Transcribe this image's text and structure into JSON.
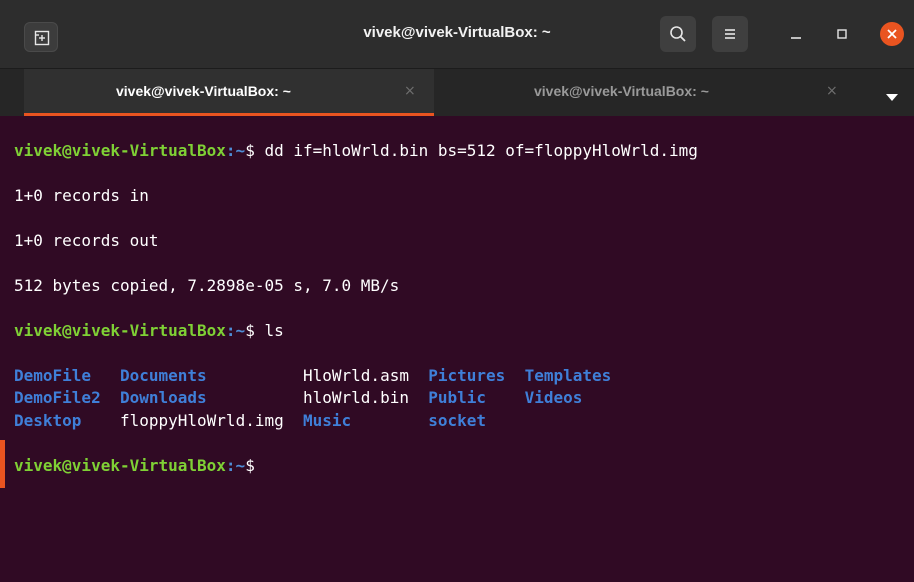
{
  "window": {
    "title": "vivek@vivek-VirtualBox: ~"
  },
  "tabs": [
    {
      "label": "vivek@vivek-VirtualBox: ~",
      "close": "×",
      "active": true
    },
    {
      "label": "vivek@vivek-VirtualBox: ~",
      "close": "×",
      "active": false
    }
  ],
  "terminal": {
    "prompt_user": "vivek@vivek-VirtualBox",
    "prompt_path": ":~",
    "prompt_symbol": "$",
    "commands": [
      " dd if=hloWrld.bin bs=512 of=floppyHloWrld.img",
      " ls"
    ],
    "output": [
      "1+0 records in",
      "1+0 records out",
      "512 bytes copied, 7.2898e-05 s, 7.0 MB/s"
    ],
    "ls_rows": [
      [
        {
          "name": "DemoFile",
          "type": "dir",
          "pad": "   "
        },
        {
          "name": "Documents",
          "type": "dir",
          "pad": "          "
        },
        {
          "name": "HloWrld.asm",
          "type": "file",
          "pad": "  "
        },
        {
          "name": "Pictures",
          "type": "dir",
          "pad": "  "
        },
        {
          "name": "Templates",
          "type": "dir",
          "pad": ""
        }
      ],
      [
        {
          "name": "DemoFile2",
          "type": "dir",
          "pad": "  "
        },
        {
          "name": "Downloads",
          "type": "dir",
          "pad": "          "
        },
        {
          "name": "hloWrld.bin",
          "type": "file",
          "pad": "  "
        },
        {
          "name": "Public",
          "type": "dir",
          "pad": "    "
        },
        {
          "name": "Videos",
          "type": "dir",
          "pad": ""
        }
      ],
      [
        {
          "name": "Desktop",
          "type": "dir",
          "pad": "    "
        },
        {
          "name": "floppyHloWrld.img",
          "type": "file",
          "pad": "  "
        },
        {
          "name": "Music",
          "type": "dir",
          "pad": "        "
        },
        {
          "name": "socket",
          "type": "dir",
          "pad": ""
        }
      ]
    ]
  },
  "colors": {
    "terminal_bg": "#300a24",
    "prompt_user": "#7fd135",
    "prompt_path": "#4e8cd6",
    "directory": "#3f7fd8",
    "accent": "#e95420"
  },
  "icons": {
    "new_tab": "new-tab-icon",
    "search": "search-icon",
    "menu": "hamburger-menu-icon",
    "minimize": "minimize-icon",
    "maximize": "maximize-icon",
    "close": "close-icon",
    "dropdown": "chevron-down-icon"
  }
}
